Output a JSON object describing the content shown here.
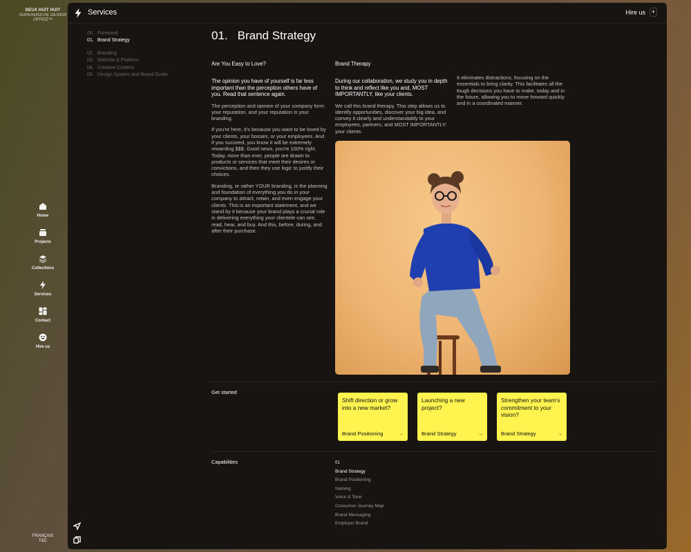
{
  "brand": {
    "line1": "DEUX HUIT HUIT",
    "line2": "SUPERDIGITAL DESIGN",
    "line3": "OFFICE™"
  },
  "nav": [
    {
      "label": "Home",
      "icon": "home-icon"
    },
    {
      "label": "Projects",
      "icon": "projects-icon"
    },
    {
      "label": "Collections",
      "icon": "layers-icon"
    },
    {
      "label": "Services",
      "icon": "bolt-icon"
    },
    {
      "label": "Contact",
      "icon": "contact-icon"
    },
    {
      "label": "Hire us",
      "icon": "smiley-icon"
    }
  ],
  "footer": {
    "lang": "FRANÇAIS",
    "terms": "T&C"
  },
  "topbar": {
    "title": "Services",
    "hire": "Hire us",
    "plus": "+"
  },
  "toc": {
    "foreword": {
      "num": "00.",
      "label": "Foreword"
    },
    "active": {
      "num": "01.",
      "label": "Brand Strategy"
    },
    "items": [
      {
        "num": "02.",
        "label": "Branding"
      },
      {
        "num": "03.",
        "label": "Website & Platform"
      },
      {
        "num": "04.",
        "label": "Creative Content"
      },
      {
        "num": "05.",
        "label": "Design System and Brand Guide"
      }
    ]
  },
  "section": {
    "num": "01.",
    "title": "Brand Strategy"
  },
  "col1": {
    "heading": "Are You Easy to Love?",
    "lead": "The opinion you have of yourself is far less important than the perception others have of you. Read that sentence again.",
    "p1": "The perception and opinion of your company form your reputation, and your reputation is your branding.",
    "p2": "If you're here, it's because you want to be loved by your clients, your bosses, or your employees. And if you succeed, you know it will be extremely rewarding $$$. Good news, you're 100% right. Today, more than ever, people are drawn to products or services that meet their desires or convictions, and then they use logic to justify their choices.",
    "p3": "Branding, or rather YOUR branding, is the planning and foundation of everything you do in your company to attract, retain, and even engage your clients. This is an important statement, and we stand by it because your brand plays a crucial role in delivering everything your clientele can see, read, hear, and buy. And this, before, during, and after their purchase."
  },
  "col2": {
    "heading": "Brand Therapy",
    "lead": "During our collaboration, we study you in depth to think and reflect like you and, MOST IMPORTANTLY, like your clients.",
    "p1": "We call this brand therapy. This step allows us to identify opportunities, discover your big idea, and convey it clearly and understandably to your employees, partners, and MOST IMPORTANTLY: your clients."
  },
  "col3": {
    "p1": "It eliminates distractions, focusing on the essentials to bring clarity. This facilitates all the tough decisions you have to make, today and in the future, allowing you to move forward quickly and in a coordinated manner."
  },
  "get_started": {
    "label": "Get started",
    "cards": [
      {
        "question": "Shift direction or grow into a new market?",
        "link": "Brand Positioning"
      },
      {
        "question": "Launching a new project?",
        "link": "Brand Strategy"
      },
      {
        "question": "Strengthen your team's commitment to your vision?",
        "link": "Brand Strategy"
      }
    ]
  },
  "capabilities": {
    "label": "Capabilities",
    "num": "01",
    "items": [
      "Brand Strategy",
      "Brand Positioning",
      "Naming",
      "Voice & Tone",
      "Consumer Journey Map",
      "Brand Messaging",
      "Employer Brand"
    ]
  },
  "colors": {
    "accent": "#fff44f",
    "panel": "#181412",
    "video_bg": "#eeb472",
    "sweater": "#1f3fb0"
  }
}
